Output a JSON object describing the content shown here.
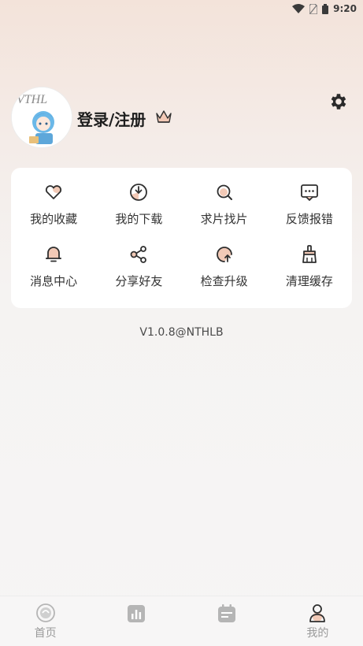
{
  "status_bar": {
    "time": "9:20",
    "icons": [
      "wifi-icon",
      "sim-icon",
      "battery-icon"
    ]
  },
  "profile": {
    "login_label": "登录/注册",
    "avatar_text": "VTHL",
    "icons": [
      "vip-crown-icon",
      "settings-gear-icon"
    ]
  },
  "menu": {
    "items": [
      {
        "label": "我的收藏",
        "icon": "heart-icon"
      },
      {
        "label": "我的下载",
        "icon": "download-icon"
      },
      {
        "label": "求片找片",
        "icon": "search-icon"
      },
      {
        "label": "反馈报错",
        "icon": "feedback-icon"
      },
      {
        "label": "消息中心",
        "icon": "bell-icon"
      },
      {
        "label": "分享好友",
        "icon": "share-icon"
      },
      {
        "label": "检查升级",
        "icon": "upgrade-icon"
      },
      {
        "label": "清理缓存",
        "icon": "clean-icon"
      }
    ]
  },
  "version": "V1.0.8@NTHLB",
  "bottom_nav": {
    "items": [
      {
        "label": "首页",
        "icon": "home-icon"
      },
      {
        "label": "",
        "icon": "chart-icon"
      },
      {
        "label": "",
        "icon": "calendar-icon"
      },
      {
        "label": "我的",
        "icon": "profile-icon"
      }
    ]
  },
  "colors": {
    "accent": "#f2c9b6",
    "icon_stroke": "#2f2f2f",
    "nav_label": "#9a9a9a"
  }
}
